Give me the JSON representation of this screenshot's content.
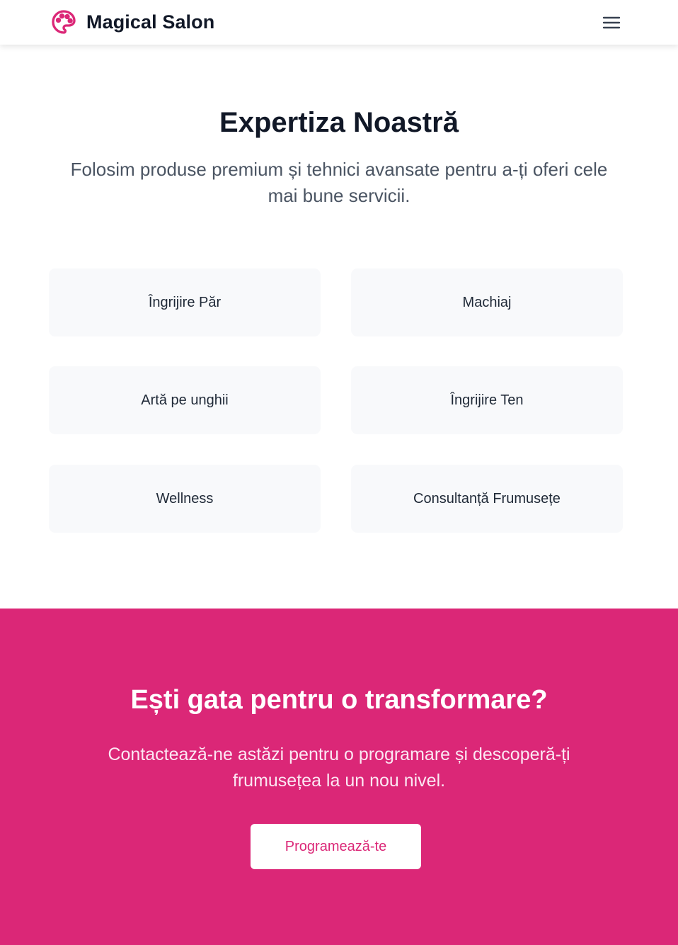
{
  "header": {
    "brand_name": "Magical Salon",
    "logo_icon": "palette-icon",
    "menu_icon": "hamburger-menu-icon"
  },
  "expertise": {
    "title": "Expertiza Noastră",
    "subtitle": "Folosim produse premium și tehnici avansate pentru a-ți oferi cele mai bune servicii.",
    "services": [
      {
        "label": "Îngrijire Păr"
      },
      {
        "label": "Machiaj"
      },
      {
        "label": "Artă pe unghii"
      },
      {
        "label": "Îngrijire Ten"
      },
      {
        "label": "Wellness"
      },
      {
        "label": "Consultanță Frumusețe"
      }
    ]
  },
  "cta": {
    "title": "Ești gata pentru o transformare?",
    "text": "Contactează-ne astăzi pentru o programare și descoperă-ți frumusețea la un nou nivel.",
    "button_label": "Programează-te"
  },
  "colors": {
    "brand_pink": "#db2777",
    "heading": "#111827",
    "body_text": "#4b5563",
    "card_bg": "#f8f9fb"
  }
}
